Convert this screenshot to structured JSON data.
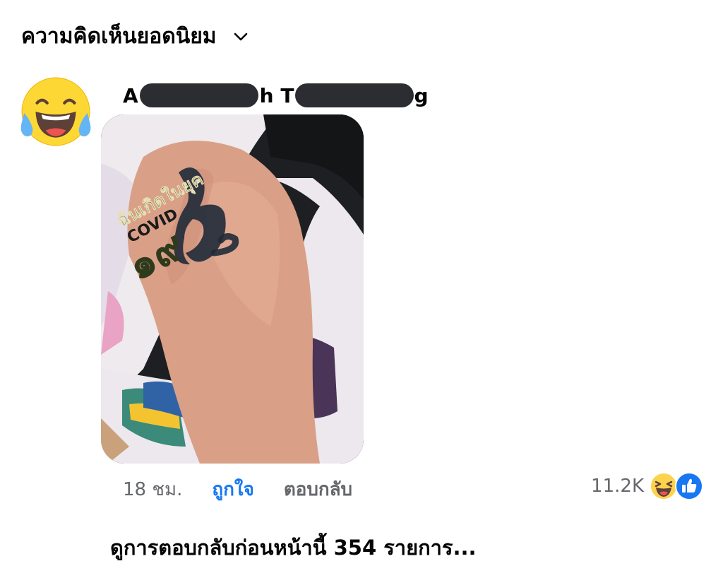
{
  "header": {
    "sort_label": "ความคิดเห็นยอดนิยม",
    "chevron_icon": "chevron-down-icon"
  },
  "comment": {
    "avatar_icon": "laughing-tears-emoji",
    "author": {
      "first_visible": "A",
      "middle_visible": "h T",
      "last_visible": "g"
    },
    "photo": {
      "tattoo_text_thai": "ฉันเกิดในยุค",
      "tattoo_text_covid": "COVID",
      "tattoo_digits": "๑๙"
    },
    "time": "18 ชม.",
    "like_label": "ถูกใจ",
    "reply_label": "ตอบกลับ",
    "reaction_count": "11.2K",
    "reaction_icons": [
      "haha-icon",
      "like-icon"
    ],
    "colors": {
      "like_blue": "#1877f2",
      "secondary_text": "#65676b"
    }
  },
  "replies": {
    "view_previous_label": "ดูการตอบกลับก่อนหน้านี้ 354 รายการ..."
  }
}
